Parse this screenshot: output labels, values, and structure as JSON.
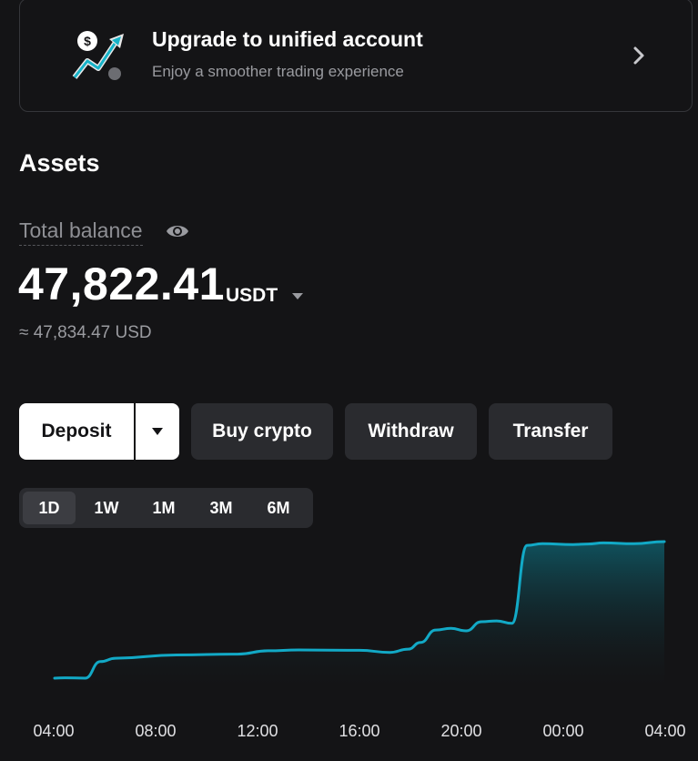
{
  "banner": {
    "title": "Upgrade to unified account",
    "subtitle": "Enjoy a smoother trading experience"
  },
  "assets": {
    "section_title": "Assets",
    "balance_label": "Total balance",
    "amount": "47,822.41",
    "currency": "USDT",
    "approx": "≈ 47,834.47 USD"
  },
  "actions": {
    "deposit": "Deposit",
    "buy_crypto": "Buy crypto",
    "withdraw": "Withdraw",
    "transfer": "Transfer"
  },
  "range_tabs": {
    "items": [
      "1D",
      "1W",
      "1M",
      "3M",
      "6M"
    ],
    "active": "1D"
  },
  "colors": {
    "line": "#12a9c6",
    "background": "#141416",
    "button": "#2a2b2f"
  },
  "icons": {
    "banner": "upgrade-trend-illustration",
    "chevron": "chevron-right-icon",
    "eye": "eye-icon",
    "caret": "caret-down-icon"
  },
  "chart_data": {
    "type": "area",
    "x_ticks": [
      "04:00",
      "08:00",
      "12:00",
      "16:00",
      "20:00",
      "00:00",
      "04:00"
    ],
    "series": [
      {
        "values": [
          [
            0,
            47000
          ],
          [
            0.017,
            47002
          ],
          [
            0.05,
            47000
          ],
          [
            0.075,
            47100
          ],
          [
            0.1,
            47120
          ],
          [
            0.2,
            47140
          ],
          [
            0.3,
            47145
          ],
          [
            0.35,
            47165
          ],
          [
            0.4,
            47170
          ],
          [
            0.5,
            47168
          ],
          [
            0.55,
            47155
          ],
          [
            0.58,
            47175
          ],
          [
            0.6,
            47215
          ],
          [
            0.625,
            47290
          ],
          [
            0.65,
            47300
          ],
          [
            0.675,
            47285
          ],
          [
            0.7,
            47340
          ],
          [
            0.725,
            47345
          ],
          [
            0.75,
            47330
          ],
          [
            0.775,
            47800
          ],
          [
            0.8,
            47810
          ],
          [
            0.85,
            47805
          ],
          [
            0.875,
            47808
          ],
          [
            0.9,
            47815
          ],
          [
            0.95,
            47810
          ],
          [
            1.0,
            47822.41
          ]
        ]
      }
    ],
    "grid": false,
    "legend": "none"
  }
}
